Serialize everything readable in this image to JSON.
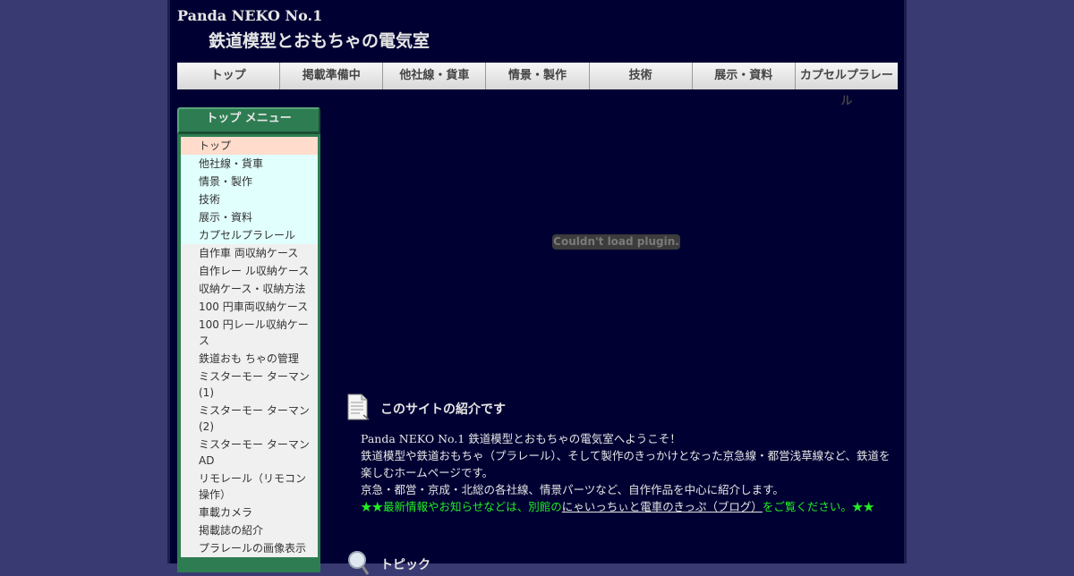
{
  "header": {
    "title": "Panda NEKO No.1",
    "subtitle": "鉄道模型とおもちゃの電気室"
  },
  "nav": {
    "items": [
      "トップ",
      "掲載準備中",
      "他社線・貨車",
      "情景・製作",
      "技術",
      "展示・資料",
      "カプセルプラレール"
    ]
  },
  "sidebar": {
    "header": "トップ メニュー",
    "items": [
      {
        "label": "トップ",
        "style": "current"
      },
      {
        "label": "他社線・貨車",
        "style": "cyan"
      },
      {
        "label": "情景・製作",
        "style": "cyan"
      },
      {
        "label": "技術",
        "style": "cyan"
      },
      {
        "label": "展示・資料",
        "style": "cyan"
      },
      {
        "label": "カプセルプラレール",
        "style": "cyan"
      },
      {
        "label": "自作車 両収納ケース",
        "style": "plain"
      },
      {
        "label": "自作レー ル収納ケース",
        "style": "plain"
      },
      {
        "label": "収納ケース・収納方法",
        "style": "plain"
      },
      {
        "label": "100 円車両収納ケース",
        "style": "plain"
      },
      {
        "label": "100 円レール収納ケース",
        "style": "plain"
      },
      {
        "label": "鉄道おも ちゃの管理",
        "style": "plain"
      },
      {
        "label": "ミスターモー ターマン(1)",
        "style": "plain"
      },
      {
        "label": "ミスターモー ターマン(2)",
        "style": "plain"
      },
      {
        "label": "ミスターモー ターマンAD",
        "style": "plain"
      },
      {
        "label": "リモレール（リモコン操作）",
        "style": "plain"
      },
      {
        "label": "車載カメラ",
        "style": "plain"
      },
      {
        "label": "掲載誌の紹介",
        "style": "plain"
      },
      {
        "label": "プラレールの画像表示",
        "style": "plain"
      }
    ]
  },
  "plugin": {
    "message": "Couldn't load plugin."
  },
  "intro": {
    "title": "このサイトの紹介です",
    "line1": "Panda NEKO No.1 鉄道模型とおもちゃの電気室へようこそ！",
    "line2": "鉄道模型や鉄道おもちゃ（プラレール）、そして製作のきっかけとなった京急線・都営浅草線など、鉄道を",
    "line3": "楽しむホームページです。",
    "line4": "京急・都営・京成・北総の各社線、情景パーツなど、自作作品を中心に紹介します。",
    "notice_pre": "★★最新情報やお知らせなどは、別館の",
    "notice_link": "にゃいっちぃと電車のきっぷ（ブログ）",
    "notice_post": "をご覧ください。★★"
  },
  "topics": {
    "title": "トピック"
  }
}
